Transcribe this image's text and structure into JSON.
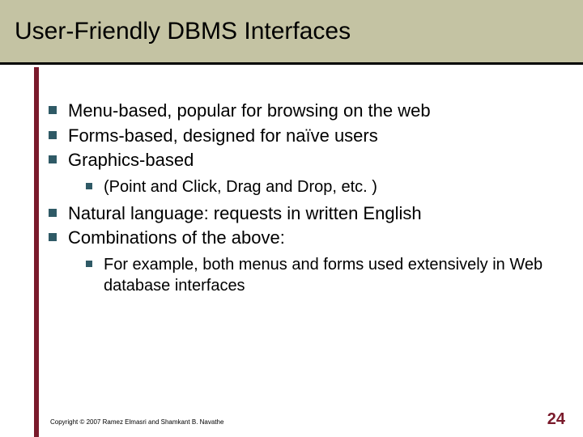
{
  "title": "User-Friendly DBMS Interfaces",
  "bullets": {
    "b1": "Menu-based, popular for browsing on the web",
    "b2": "Forms-based, designed for naïve users",
    "b3": "Graphics-based",
    "b3a": "(Point and Click, Drag and Drop, etc. )",
    "b4": "Natural language: requests in written English",
    "b5": "Combinations of the above:",
    "b5a": "For example, both menus and forms used extensively in Web database interfaces"
  },
  "footer": {
    "copyright": "Copyright © 2007 Ramez Elmasri and Shamkant B. Navathe",
    "page_number": "24"
  }
}
